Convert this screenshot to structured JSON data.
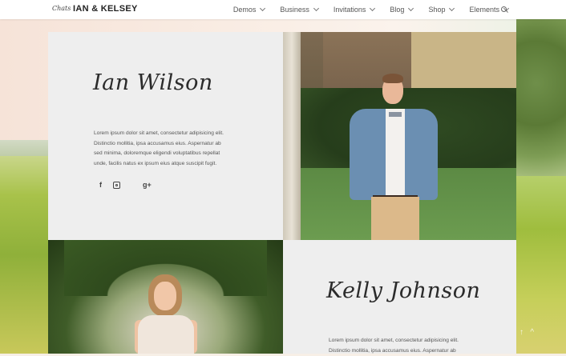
{
  "brand": {
    "script": "Chats",
    "name": "IAN & KELSEY"
  },
  "nav": {
    "items": [
      {
        "label": "Demos"
      },
      {
        "label": "Business"
      },
      {
        "label": "Invitations"
      },
      {
        "label": "Blog"
      },
      {
        "label": "Shop"
      },
      {
        "label": "Elements"
      }
    ]
  },
  "groom": {
    "name": "Ian Wilson",
    "bio_lines": [
      "Lorem ipsum dolor sit amet, consectetur adipisicing elit.",
      "Distinctio mollitia, ipsa accusamus eius. Aspernatur ab",
      "sed minima, doloremque eligendi voluptatibus repellat",
      "unde, facilis natus ex ipsum eius atque suscipit fugit."
    ],
    "social": [
      "f",
      "instagram",
      "g+"
    ]
  },
  "bride": {
    "name": "Kelly Johnson",
    "bio_lines": [
      "Lorem ipsum dolor sit amet, consectetur adipisicing elit.",
      "Distinctio mollitia, ipsa accusamus eius. Aspernatur ab"
    ]
  },
  "icons": {
    "search": "search-icon",
    "facebook": "facebook-icon",
    "instagram": "instagram-icon",
    "google_plus": "google-plus-icon"
  }
}
